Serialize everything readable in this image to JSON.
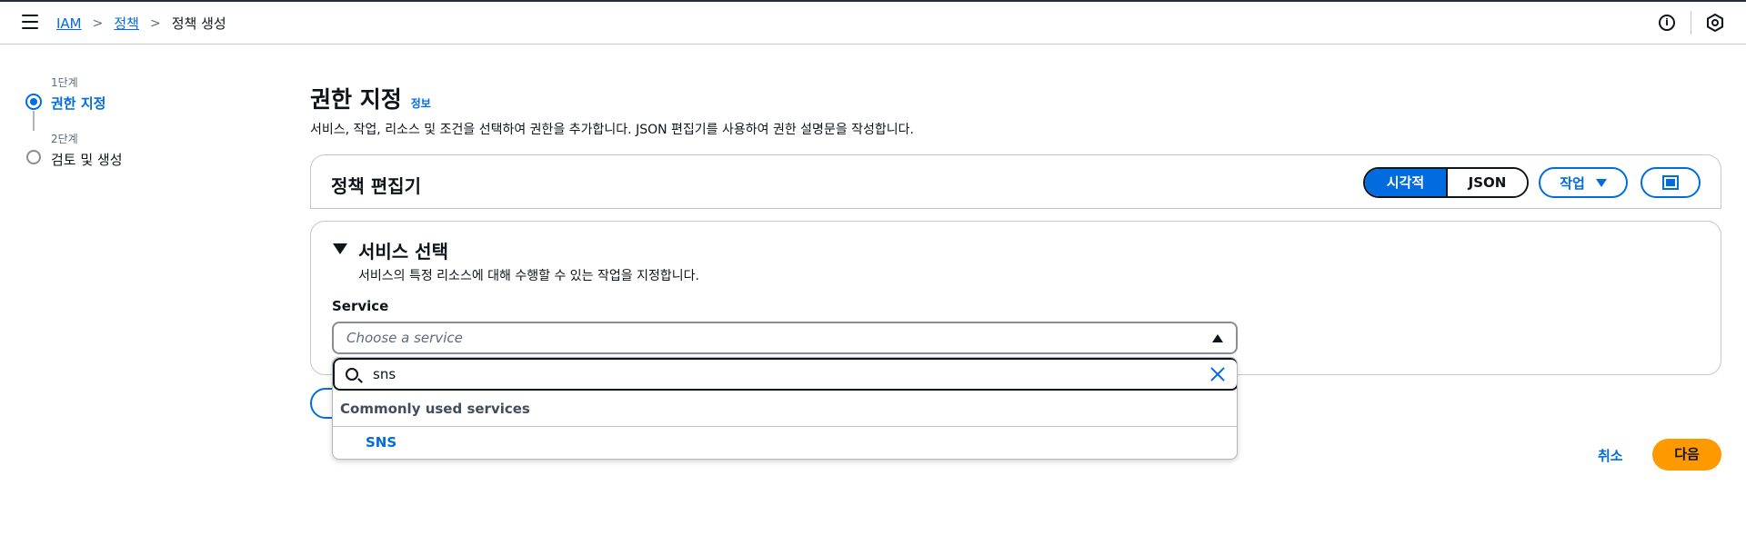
{
  "topbar": {
    "breadcrumbs": [
      "IAM",
      "정책",
      "정책 생성"
    ],
    "info_icon": "i"
  },
  "stepper": {
    "steps": [
      {
        "num": "1단계",
        "label": "권한 지정"
      },
      {
        "num": "2단계",
        "label": "검토 및 생성"
      }
    ]
  },
  "main": {
    "title": "권한 지정",
    "info_link": "정보",
    "description": "서비스, 작업, 리소스 및 조건을 선택하여 권한을 추가합니다. JSON 편집기를 사용하여 권한 설명문을 작성합니다."
  },
  "editor": {
    "title": "정책 편집기",
    "segments": [
      "시각적",
      "JSON"
    ],
    "action_label": "작업"
  },
  "service": {
    "title": "서비스 선택",
    "description": "서비스의 특정 리소스에 대해 수행할 수 있는 작업을 지정합니다.",
    "label": "Service",
    "placeholder": "Choose a service"
  },
  "dropdown": {
    "search_value": "sns",
    "group_label": "Commonly used services",
    "options": [
      "SNS"
    ]
  },
  "footer": {
    "cancel": "취소",
    "next": "다음"
  },
  "colors": {
    "accent": "#006ce0",
    "primary_button": "#ff9900"
  }
}
